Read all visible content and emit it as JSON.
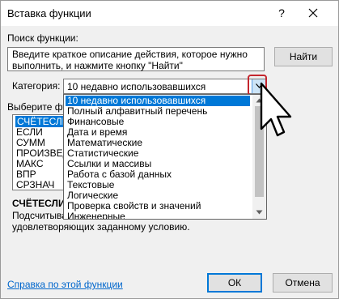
{
  "window": {
    "title": "Вставка функции",
    "help_glyph": "?",
    "close_icon": "close-icon"
  },
  "search": {
    "label": "Поиск функции:",
    "description": "Введите краткое описание действия, которое нужно выполнить, и нажмите кнопку \"Найти\"",
    "find_button": "Найти"
  },
  "category": {
    "label": "Категория:",
    "selected": "10 недавно использовавшихся",
    "options": [
      "10 недавно использовавшихся",
      "Полный алфавитный перечень",
      "Финансовые",
      "Дата и время",
      "Математические",
      "Статистические",
      "Ссылки и массивы",
      "Работа с базой данных",
      "Текстовые",
      "Логические",
      "Проверка свойств и значений",
      "Инженерные"
    ]
  },
  "functions": {
    "label": "Выберите фу",
    "items": [
      "СЧЁТЕСЛИ",
      "ЕСЛИ",
      "СУММ",
      "ПРОИЗВЕД",
      "МАКС",
      "ВПР",
      "СРЗНАЧ"
    ],
    "selected_name": "СЧЁТЕСЛИ",
    "description_line1": "Подсчитыва",
    "description_line2": "удовлетворяющих заданному условию."
  },
  "footer": {
    "help_link": "Справка по этой функции",
    "ok_button": "ОК",
    "cancel_button": "Отмена"
  },
  "colors": {
    "selection": "#0078d7",
    "highlight_border": "#c4262e",
    "link": "#0066cc"
  }
}
